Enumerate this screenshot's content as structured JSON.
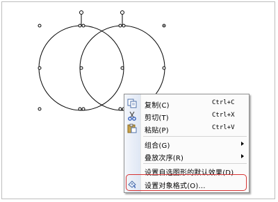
{
  "menu": {
    "items": [
      {
        "label": "复制(C)",
        "shortcut": "Ctrl+C",
        "icon": "copy-icon"
      },
      {
        "label": "剪切(T)",
        "shortcut": "Ctrl+X",
        "icon": "scissors-icon"
      },
      {
        "label": "粘贴(P)",
        "shortcut": "Ctrl+V",
        "icon": "paste-icon"
      },
      {
        "label": "组合(G)",
        "icon": "submenu-arrow-icon"
      },
      {
        "label": "叠放次序(R)",
        "icon": "submenu-arrow-icon"
      },
      {
        "label": "设置自选图形的默认效果(D)"
      },
      {
        "label": "设置对象格式(O)...",
        "icon": "format-object-icon"
      }
    ]
  },
  "colors": {
    "highlight": "#d63232",
    "menu_border": "#8e8e8e",
    "shape_outline": "#000000"
  }
}
